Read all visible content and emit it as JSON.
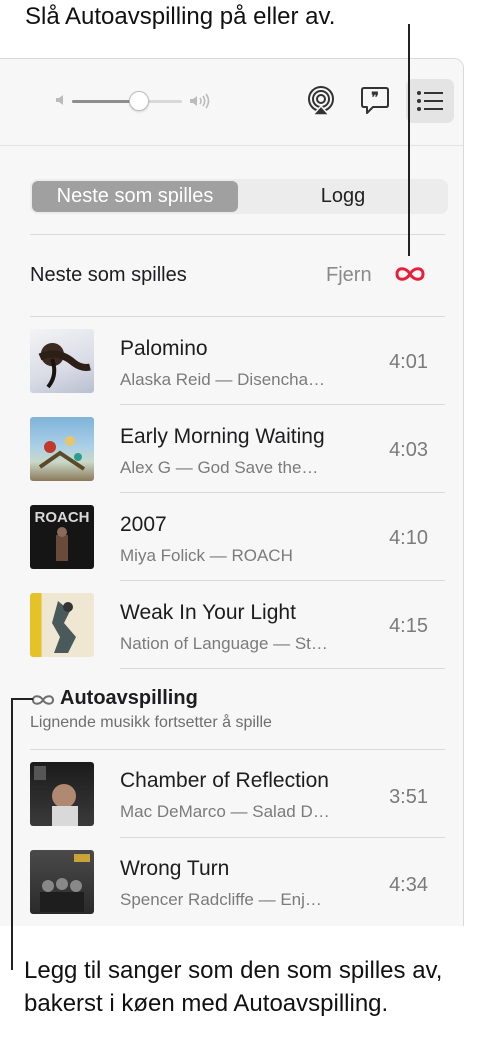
{
  "callouts": {
    "top": "Slå Autoavspilling på eller av.",
    "bottom": "Legg til sanger som den som spilles av, bakerst i køen med Autoavspilling."
  },
  "toolbar": {
    "volume_level_percent": 60,
    "icons": [
      "volume-low-icon",
      "volume-high-icon",
      "airplay-icon",
      "lyrics-icon",
      "queue-list-icon"
    ]
  },
  "tabs": [
    {
      "label": "Neste som spilles",
      "active": true
    },
    {
      "label": "Logg",
      "active": false
    }
  ],
  "up_next": {
    "title": "Neste som spilles",
    "clear_label": "Fjern",
    "autoplay_on": true,
    "songs": [
      {
        "title": "Palomino",
        "subtitle": "Alaska Reid — Disencha…",
        "duration": "4:01"
      },
      {
        "title": "Early Morning Waiting",
        "subtitle": "Alex G — God Save the…",
        "duration": "4:03"
      },
      {
        "title": "2007",
        "subtitle": "Miya Folick — ROACH",
        "duration": "4:10"
      },
      {
        "title": "Weak In Your Light",
        "subtitle": "Nation of Language — St…",
        "duration": "4:15"
      }
    ]
  },
  "autoplay": {
    "title": "Autoavspilling",
    "subtitle": "Lignende musikk fortsetter å spille",
    "songs": [
      {
        "title": "Chamber of Reflection",
        "subtitle": "Mac DeMarco — Salad D…",
        "duration": "3:51"
      },
      {
        "title": "Wrong Turn",
        "subtitle": "Spencer Radcliffe — Enj…",
        "duration": "4:34"
      }
    ]
  },
  "art_labels": {
    "roach": "ROACH"
  },
  "colors": {
    "accent": "#e5203a",
    "tab_active": "#a0a0a0",
    "secondary_text": "#7b7b7b"
  }
}
